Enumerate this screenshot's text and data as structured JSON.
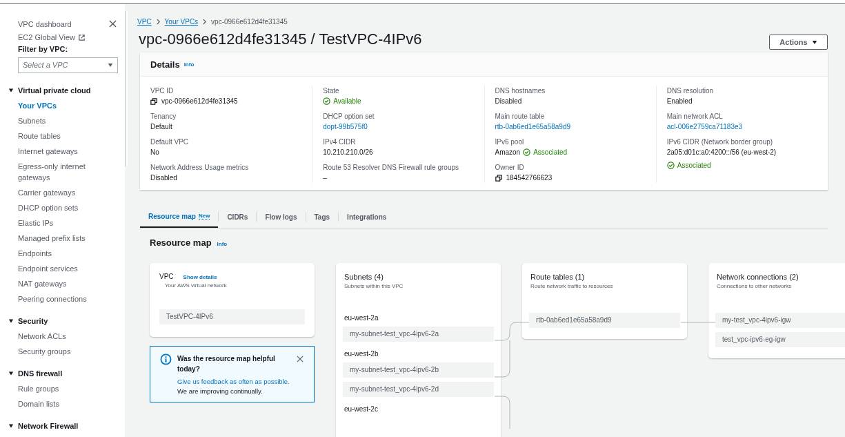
{
  "sidebar": {
    "header": {
      "label": "VPC dashboard"
    },
    "links": [
      {
        "label": "EC2 Global View",
        "external": true
      }
    ],
    "filter": {
      "label": "Filter by VPC:",
      "placeholder": "Select a VPC"
    },
    "sections": [
      {
        "title": "Virtual private cloud",
        "expanded": true,
        "items": [
          {
            "label": "Your VPCs",
            "selected": true
          },
          {
            "label": "Subnets",
            "selected": false
          },
          {
            "label": "Route tables",
            "selected": false
          },
          {
            "label": "Internet gateways",
            "selected": false
          },
          {
            "label": "Egress-only internet gateways",
            "selected": false
          },
          {
            "label": "Carrier gateways",
            "selected": false
          },
          {
            "label": "DHCP option sets",
            "selected": false
          },
          {
            "label": "Elastic IPs",
            "selected": false
          },
          {
            "label": "Managed prefix lists",
            "selected": false
          },
          {
            "label": "Endpoints",
            "selected": false
          },
          {
            "label": "Endpoint services",
            "selected": false
          },
          {
            "label": "NAT gateways",
            "selected": false
          },
          {
            "label": "Peering connections",
            "selected": false
          }
        ]
      },
      {
        "title": "Security",
        "expanded": true,
        "items": [
          {
            "label": "Network ACLs",
            "selected": false
          },
          {
            "label": "Security groups",
            "selected": false
          }
        ]
      },
      {
        "title": "DNS firewall",
        "expanded": true,
        "items": [
          {
            "label": "Rule groups",
            "selected": false
          },
          {
            "label": "Domain lists",
            "selected": false
          }
        ]
      },
      {
        "title": "Network Firewall",
        "expanded": true
      }
    ]
  },
  "breadcrumb": [
    {
      "label": "VPC",
      "kind": "link"
    },
    {
      "label": "Your VPCs",
      "kind": "link"
    },
    {
      "label": "vpc-0966e612d4fe31345",
      "kind": "current"
    }
  ],
  "title": "vpc-0966e612d4fe31345 / TestVPC-4IPv6",
  "actions_button": "Actions",
  "details": {
    "title": "Details",
    "info": "Info",
    "columns": [
      [
        {
          "label": "VPC ID",
          "kind": "copy",
          "value": "vpc-0966e612d4fe31345"
        },
        {
          "label": "Tenancy",
          "kind": "text",
          "value": "Default"
        },
        {
          "label": "Default VPC",
          "kind": "text",
          "value": "No"
        },
        {
          "label": "Network Address Usage metrics",
          "kind": "text",
          "value": "Disabled"
        }
      ],
      [
        {
          "label": "State",
          "kind": "status",
          "status": "Available"
        },
        {
          "label": "DHCP option set",
          "kind": "link",
          "value": "dopt-99b575f0"
        },
        {
          "label": "IPv4 CIDR",
          "kind": "text",
          "value": "10.210.210.0/26"
        },
        {
          "label": "Route 53 Resolver DNS Firewall rule groups",
          "kind": "text",
          "value": "–"
        }
      ],
      [
        {
          "label": "DNS hostnames",
          "kind": "text",
          "value": "Disabled"
        },
        {
          "label": "Main route table",
          "kind": "link",
          "value": "rtb-0ab6ed1e65a58a9d9"
        },
        {
          "label": "IPv6 pool",
          "kind": "inline_status",
          "value": "Amazon",
          "status": "Associated"
        },
        {
          "label": "Owner ID",
          "kind": "copy",
          "value": "184542766623"
        }
      ],
      [
        {
          "label": "DNS resolution",
          "kind": "text",
          "value": "Enabled"
        },
        {
          "label": "Main network ACL",
          "kind": "link",
          "value": "acl-006e2759ca71183e3"
        },
        {
          "label": "IPv6 CIDR (Network border group)",
          "kind": "below_status",
          "value": "2a05:d01c:a0:4200::/56 (eu-west-2)",
          "status": "Associated"
        }
      ]
    ]
  },
  "tabs": [
    {
      "label": "Resource map",
      "badge": "New",
      "selected": true
    },
    {
      "label": "CIDRs",
      "selected": false
    },
    {
      "label": "Flow logs",
      "selected": false
    },
    {
      "label": "Tags",
      "selected": false
    },
    {
      "label": "Integrations",
      "selected": false
    }
  ],
  "resource_map": {
    "title": "Resource map",
    "info": "Info",
    "vpc": {
      "title": "VPC",
      "link": "Show details",
      "subtitle": "Your AWS virtual network",
      "items": [
        "TestVPC-4IPv6"
      ]
    },
    "feedback": {
      "title": "Was the resource map helpful today?",
      "link": "Give us feedback as often as possible.",
      "text": "We are improving continually."
    },
    "subnets": {
      "title": "Subnets (4)",
      "subtitle": "Subnets within this VPC",
      "groups": [
        {
          "zone": "eu-west-2a",
          "items": [
            "my-subnet-test_vpc-4ipv6-2a"
          ]
        },
        {
          "zone": "eu-west-2b",
          "items": [
            "my-subnet-test_vpc-4ipv6-2b",
            "my-subnet-test_vpc-4ipv6-2d"
          ]
        },
        {
          "zone": "eu-west-2c"
        }
      ]
    },
    "route_tables": {
      "title": "Route tables (1)",
      "subtitle": "Route network traffic to resources",
      "items": [
        "rtb-0ab6ed1e65a58a9d9"
      ]
    },
    "network_connections": {
      "title": "Network connections (2)",
      "subtitle": "Connections to other networks",
      "items": [
        "my-test_vpc-4ipv6-igw",
        "test_vpc-ipv6-eg-igw"
      ]
    }
  }
}
